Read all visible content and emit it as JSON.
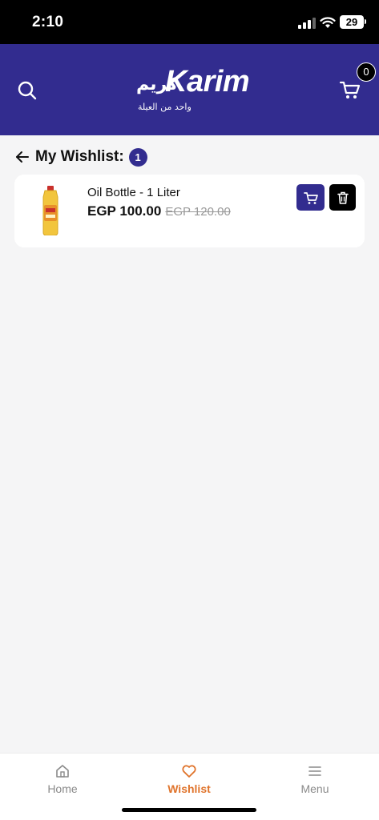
{
  "status_bar": {
    "time": "2:10",
    "battery": "29"
  },
  "header": {
    "logo_arabic": "كريم",
    "logo_english": "Karim",
    "logo_tagline": "واحد من العيلة",
    "cart_count": "0",
    "icons": {
      "search": "search-icon",
      "cart": "cart-icon"
    }
  },
  "wishlist": {
    "title": "My Wishlist:",
    "count": "1",
    "items": [
      {
        "name": "Oil Bottle - 1 Liter",
        "price": "EGP 100.00",
        "old_price": "EGP 120.00",
        "image": "oil-bottle-image"
      }
    ]
  },
  "bottom_nav": {
    "items": [
      {
        "label": "Home",
        "icon": "home-icon",
        "active": false
      },
      {
        "label": "Wishlist",
        "icon": "heart-icon",
        "active": true
      },
      {
        "label": "Menu",
        "icon": "menu-icon",
        "active": false
      }
    ]
  },
  "colors": {
    "brand": "#322c8f",
    "accent": "#e0742c",
    "background": "#f5f5f6"
  }
}
